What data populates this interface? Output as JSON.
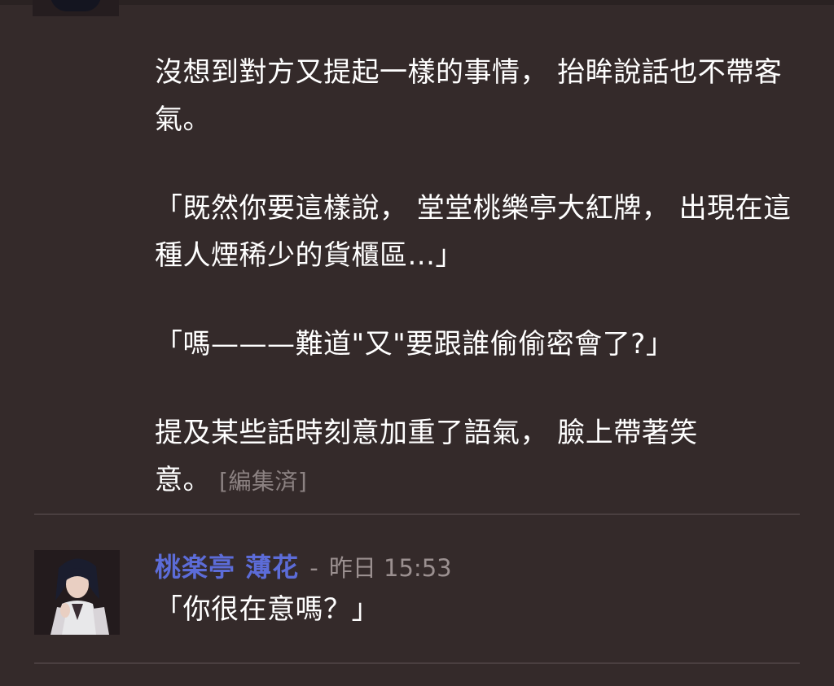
{
  "message1": {
    "paragraphs": [
      "沒想到對方又提起一樣的事情， 抬眸說話也不帶客氣。",
      "「既然你要這樣說， 堂堂桃樂亭大紅牌， 出現在這種人煙稀少的貨櫃區...」",
      "「嗎———難道\"又\"要跟誰偷偷密會了?」",
      "提及某些話時刻意加重了語氣， 臉上帶著笑意。"
    ],
    "edited_label": "[編集済]"
  },
  "message2": {
    "author": "桃楽亭 薄花",
    "separator": "-",
    "timestamp": "昨日 15:53",
    "text": "「你很在意嗎？」",
    "avatar_icon": "character-avatar"
  },
  "colors": {
    "background": "#342a2a",
    "author": "#5c6cd8",
    "text": "#ffffff",
    "meta": "#9b9090",
    "divider": "#4a3f40"
  }
}
